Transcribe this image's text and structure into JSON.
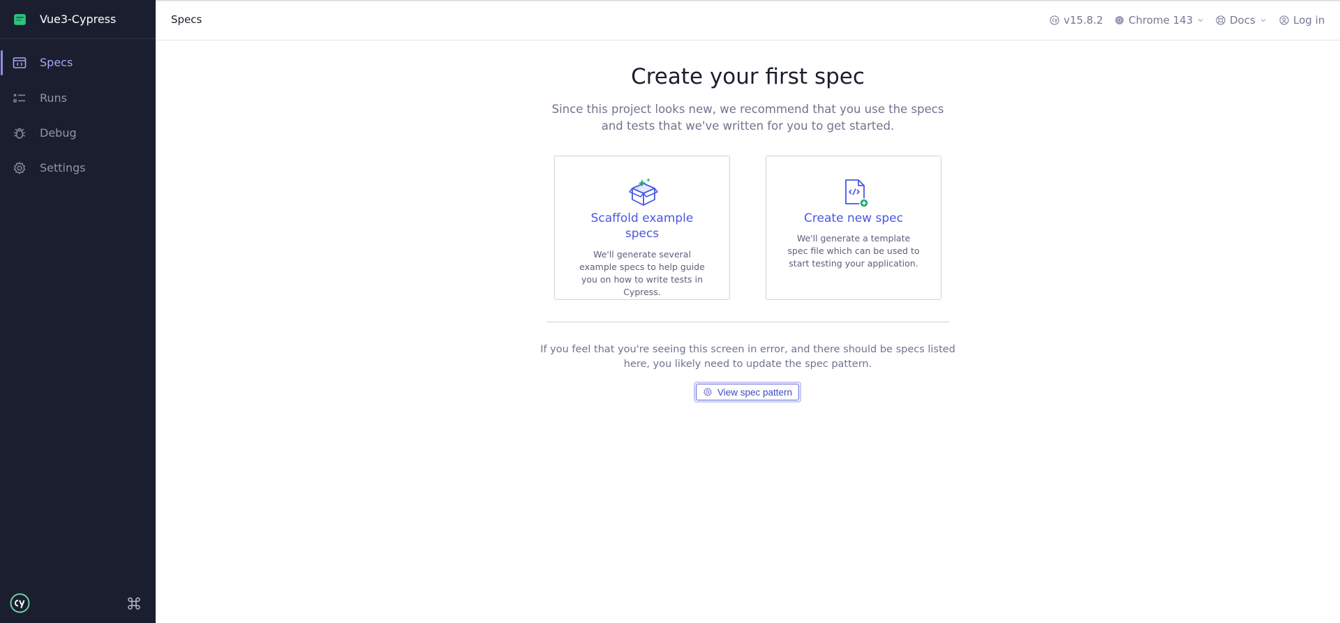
{
  "app": {
    "name": "Vue3-Cypress"
  },
  "sidebar": {
    "items": [
      {
        "label": "Specs",
        "icon": "specs-icon",
        "active": true
      },
      {
        "label": "Runs",
        "icon": "runs-icon",
        "active": false
      },
      {
        "label": "Debug",
        "icon": "debug-icon",
        "active": false
      },
      {
        "label": "Settings",
        "icon": "settings-gear-icon",
        "active": false
      }
    ]
  },
  "topbar": {
    "breadcrumb": "Specs",
    "version": "v15.8.2",
    "browser": "Chrome 143",
    "docs": "Docs",
    "login": "Log in"
  },
  "main": {
    "title": "Create your first spec",
    "subtitle_line1": "Since this project looks new, we recommend that you use the specs",
    "subtitle_line2": "and tests that we've written for you to get started.",
    "cards": [
      {
        "title": "Scaffold example specs",
        "desc": "We'll generate several example specs to help guide you on how to write tests in Cypress.",
        "icon": "box-sparkle-icon"
      },
      {
        "title": "Create new spec",
        "desc": "We'll generate a template spec file which can be used to start testing your application.",
        "icon": "file-code-plus-icon"
      }
    ],
    "error_line1": "If you feel that you're seeing this screen in error, and there should be specs listed",
    "error_line2": "here, you likely need to update the spec pattern.",
    "view_button": "View spec pattern"
  },
  "colors": {
    "sidebar_bg": "#1b1e2e",
    "accent": "#4956e3",
    "active_nav": "#a3a9f5",
    "success": "#1fa971"
  }
}
